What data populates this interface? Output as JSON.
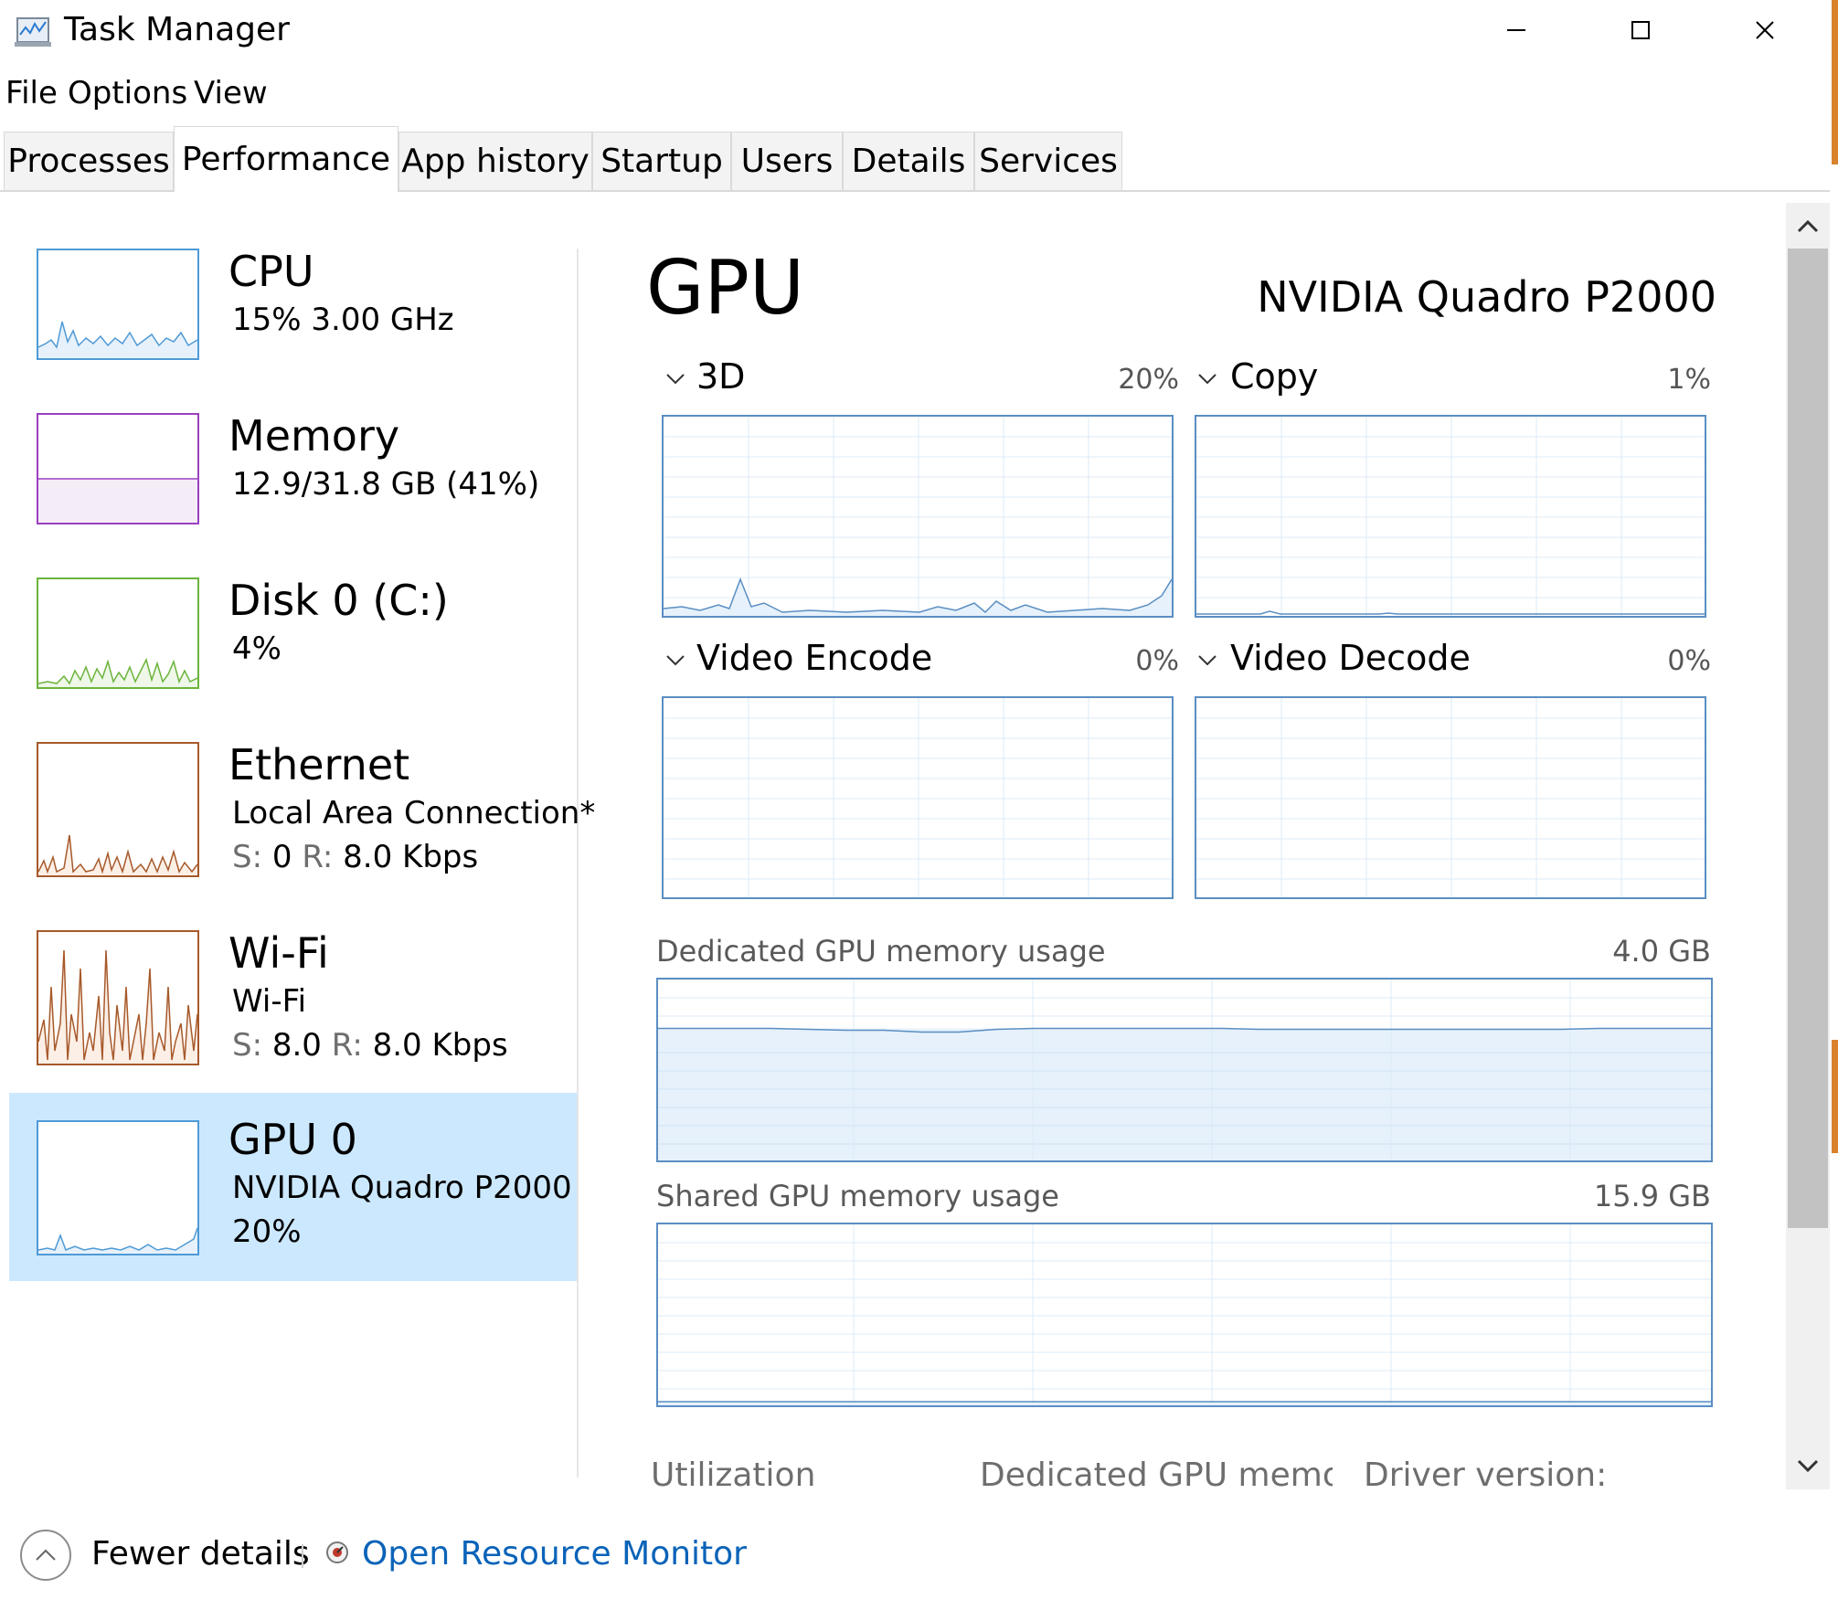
{
  "window": {
    "title": "Task Manager"
  },
  "menu": [
    "File",
    "Options",
    "View"
  ],
  "tabs": [
    "Processes",
    "Performance",
    "App history",
    "Startup",
    "Users",
    "Details",
    "Services"
  ],
  "active_tab": "Performance",
  "resources": [
    {
      "name": "CPU",
      "line1": "15%  3.00 GHz",
      "color": "#4f9ad6",
      "fill": "#e6f1fb"
    },
    {
      "name": "Memory",
      "line1": "12.9/31.8 GB (41%)",
      "color": "#9b3fbf",
      "fill": "#f4ecf7"
    },
    {
      "name": "Disk 0 (C:)",
      "line1": "4%",
      "color": "#6bb43a",
      "fill": "#eef7e8"
    },
    {
      "name": "Ethernet",
      "line1": "Local Area Connection*",
      "send_label": "S:",
      "send": "0",
      "recv_label": "R:",
      "recv": "8.0 Kbps",
      "color": "#a7592a",
      "fill": "#fbefe6"
    },
    {
      "name": "Wi-Fi",
      "line1": "Wi-Fi",
      "send_label": "S:",
      "send": "8.0",
      "recv_label": "R:",
      "recv": "8.0 Kbps",
      "color": "#a7592a",
      "fill": "#fbefe6"
    },
    {
      "name": "GPU 0",
      "line1": "NVIDIA Quadro P2000",
      "line2": "20%",
      "color": "#4f9ad6",
      "fill": "#e6f1fb"
    }
  ],
  "gpu": {
    "title": "GPU",
    "name": "NVIDIA Quadro P2000",
    "engines": [
      {
        "label": "3D",
        "pct": "20%"
      },
      {
        "label": "Copy",
        "pct": "1%"
      },
      {
        "label": "Video Encode",
        "pct": "0%"
      },
      {
        "label": "Video Decode",
        "pct": "0%"
      }
    ],
    "dedicated": {
      "label": "Dedicated GPU memory usage",
      "value": "4.0 GB",
      "fraction": 0.73
    },
    "shared": {
      "label": "Shared GPU memory usage",
      "value": "15.9 GB",
      "fraction": 0.02
    },
    "stats": [
      "Utilization",
      "Dedicated GPU memory",
      "Driver version:"
    ]
  },
  "footer": {
    "fewer": "Fewer details",
    "resource_monitor": "Open Resource Monitor"
  },
  "colors": {
    "accent_link": "#0a63b8",
    "selection": "#cce8ff",
    "gpu_line": "#5a8ec2"
  }
}
